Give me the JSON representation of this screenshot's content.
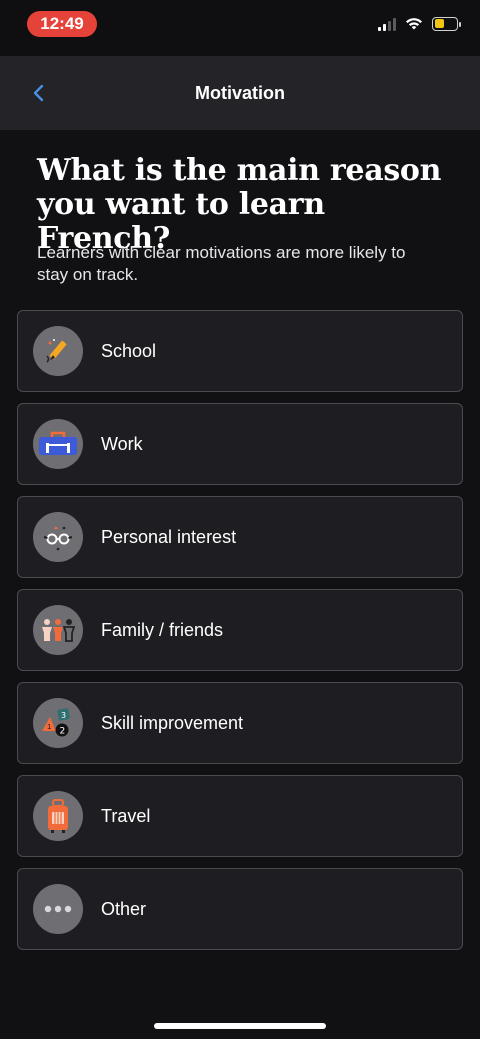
{
  "status_bar": {
    "time": "12:49",
    "icons": [
      "cellular-signal-icon",
      "wifi-icon",
      "battery-icon"
    ],
    "battery_level": 0.45,
    "time_pill_color": "#e5433a",
    "battery_color": "#f3c414"
  },
  "nav": {
    "title": "Motivation",
    "back_icon": "chevron-left-icon",
    "accent": "#4a90e2"
  },
  "heading": "What is the main reason you want to learn French?",
  "subheading": "Learners with clear motivations are more likely to stay on track.",
  "options": [
    {
      "label": "School",
      "icon": "pencil-icon"
    },
    {
      "label": "Work",
      "icon": "briefcase-icon"
    },
    {
      "label": "Personal interest",
      "icon": "glasses-icon"
    },
    {
      "label": "Family / friends",
      "icon": "people-icon"
    },
    {
      "label": "Skill improvement",
      "icon": "number-tiles-icon"
    },
    {
      "label": "Travel",
      "icon": "suitcase-icon"
    },
    {
      "label": "Other",
      "icon": "ellipsis-icon"
    }
  ],
  "colors": {
    "background": "#111114",
    "card": "#1e1e22",
    "card_border": "#4a4a50",
    "icon_circle": "#6e6e73"
  }
}
